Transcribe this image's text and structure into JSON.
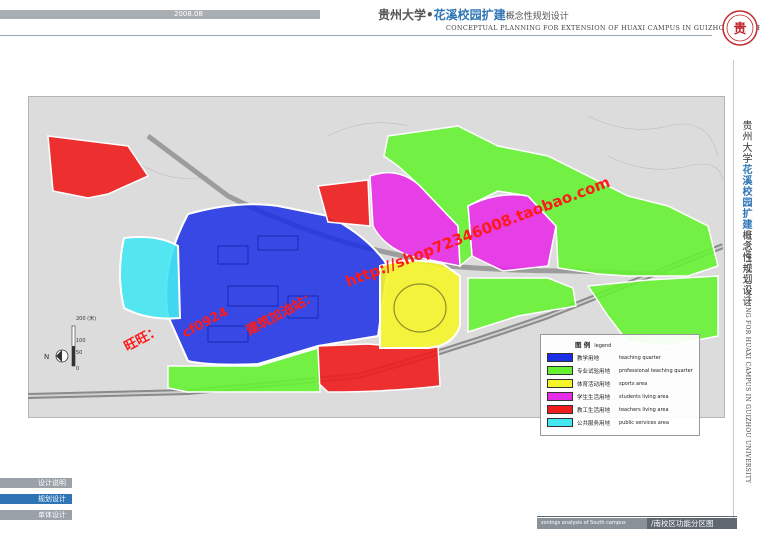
{
  "header": {
    "year": "2008.08",
    "title_part1": "贵州大学•",
    "title_part2": "花溪校园扩建",
    "title_part3": "概念性规划设计",
    "title_en": "CONCEPTUAL PLANNING FOR EXTENSION OF HUAXI CAMPUS IN GUIZHOU UNIVERSITY",
    "logo_char": "贵"
  },
  "side_title": {
    "cn_part1": "贵州大学",
    "cn_part2": "花溪校园扩建",
    "cn_part3": "概念性规划设计",
    "en": "CONCEPTUAL PLANNING FOR HUAXI CAMPUS IN GUIZHOU UNIVERSITY"
  },
  "map": {
    "north_label": "N",
    "scale_labels": [
      "0",
      "50",
      "100",
      "200 (米)"
    ]
  },
  "legend": {
    "title": "图 例",
    "title_en": "legend",
    "items": [
      {
        "cn": "教学用地",
        "en": "teaching quarter",
        "color": "#1a2ee6"
      },
      {
        "cn": "专业试验用地",
        "en": "professional teaching quarter",
        "color": "#66f233"
      },
      {
        "cn": "体育活动用地",
        "en": "sports area",
        "color": "#f5f52a"
      },
      {
        "cn": "学生生活用地",
        "en": "students living area",
        "color": "#e52de5"
      },
      {
        "cn": "教工生活用地",
        "en": "teachers living area",
        "color": "#ee1c1c"
      },
      {
        "cn": "公共服务用地",
        "en": "public services area",
        "color": "#44e6f2"
      }
    ]
  },
  "nav": {
    "item1": "设计说明",
    "item2": "规划设计",
    "item3": "单体设计"
  },
  "footer": {
    "en": "zonings analysis of South campus",
    "cn": "/南校区功能分区图"
  },
  "watermarks": {
    "w1": "旺旺：",
    "w2": "cf0924",
    "w3": "建筑加油站：",
    "w4": "http://shop72346008.taobao.com"
  }
}
